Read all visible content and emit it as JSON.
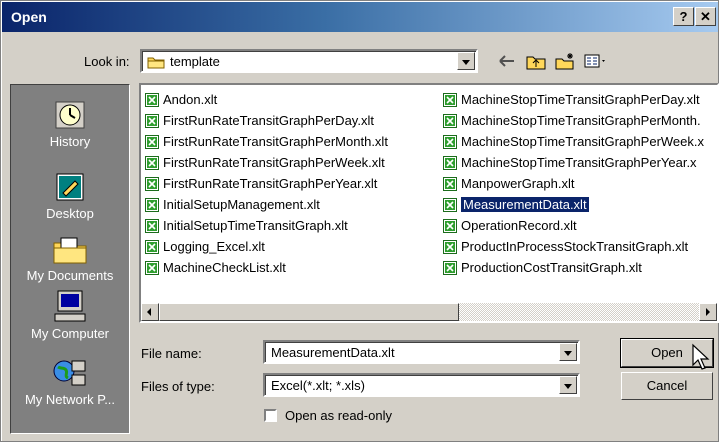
{
  "window": {
    "title": "Open",
    "help_label": "?",
    "close_label": "✕"
  },
  "lookin": {
    "label": "Look in:",
    "value": "template"
  },
  "places": [
    {
      "label": "History",
      "icon": "history-icon"
    },
    {
      "label": "Desktop",
      "icon": "desktop-icon"
    },
    {
      "label": "My Documents",
      "icon": "my-documents-icon"
    },
    {
      "label": "My Computer",
      "icon": "my-computer-icon"
    },
    {
      "label": "My Network P...",
      "icon": "my-network-places-icon"
    }
  ],
  "files": {
    "col1": [
      "Andon.xlt",
      "FirstRunRateTransitGraphPerDay.xlt",
      "FirstRunRateTransitGraphPerMonth.xlt",
      "FirstRunRateTransitGraphPerWeek.xlt",
      "FirstRunRateTransitGraphPerYear.xlt",
      "InitialSetupManagement.xlt",
      "InitialSetupTimeTransitGraph.xlt",
      "Logging_Excel.xlt",
      "MachineCheckList.xlt"
    ],
    "col2": [
      "MachineStopTimeTransitGraphPerDay.xlt",
      "MachineStopTimeTransitGraphPerMonth.",
      "MachineStopTimeTransitGraphPerWeek.x",
      "MachineStopTimeTransitGraphPerYear.x",
      "ManpowerGraph.xlt",
      "MeasurementData.xlt",
      "OperationRecord.xlt",
      "ProductInProcessStockTransitGraph.xlt",
      "ProductionCostTransitGraph.xlt"
    ],
    "selected": "MeasurementData.xlt"
  },
  "filename": {
    "label": "File name:",
    "value": "MeasurementData.xlt"
  },
  "filetype": {
    "label": "Files of type:",
    "value": "Excel(*.xlt; *.xls)"
  },
  "readonly": {
    "label": "Open as read-only",
    "checked": false
  },
  "buttons": {
    "open": "Open",
    "cancel": "Cancel"
  },
  "colors": {
    "selection": "#0a246a",
    "title_start": "#0a246a",
    "face": "#d4d0c8"
  }
}
